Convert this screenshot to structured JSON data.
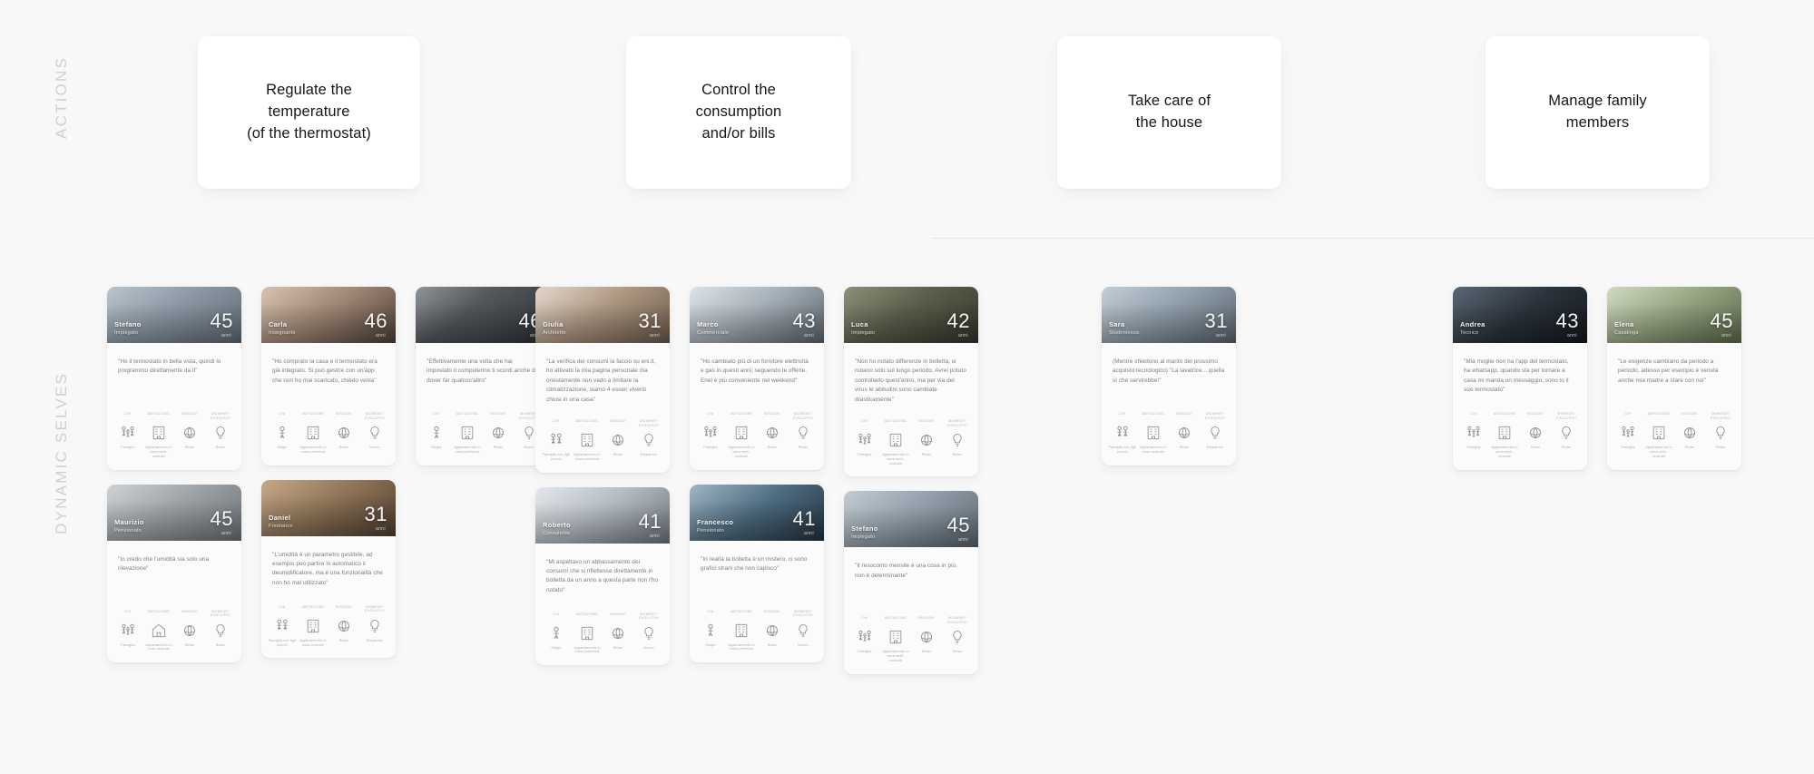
{
  "rails": {
    "actions": "ACTIONS",
    "dynamic_selves": "DYNAMIC SELVES"
  },
  "actions": {
    "cards": [
      {
        "label": "Regulate the\ntemperature\n(of the thermostat)"
      },
      {
        "label": "Control the\nconsumption\nand/or bills"
      },
      {
        "label": "Take care of\nthe house"
      },
      {
        "label": "Manage family\nmembers"
      }
    ]
  },
  "attribute_headers": [
    "CHI",
    "ABITAZIONE",
    "BISOGNI",
    "MOMENTI EVOLUTIVI"
  ],
  "columns": [
    {
      "rows": [
        [
          {
            "name": "Stefano",
            "role": "Impiegato",
            "age": "45",
            "age_unit": "anni",
            "photo": "ph-bed",
            "quote": "\"Ho il termostato in bella vista, quindi lo programmo direttamente da lì\"",
            "attrs": [
              {
                "head": "CHI",
                "icon": "family-icon",
                "cap": "Famiglia"
              },
              {
                "head": "ABITAZIONE",
                "icon": "building-icon",
                "cap": "Appartamento\nin zona semi-centrale"
              },
              {
                "head": "BISOGNI",
                "icon": "comfort-icon",
                "cap": "Relax"
              },
              {
                "head": "MOMENTI EVOLUTIVI",
                "icon": "lightbulb-icon",
                "cap": "Relax"
              }
            ]
          },
          {
            "name": "Carla",
            "role": "Insegnante",
            "age": "46",
            "age_unit": "anni",
            "photo": "ph-woman",
            "quote": "\"Ho comprato la casa e il termostato era già integrato. Si può gestire con un'app che non ho mai scaricato, chiedo venia\"",
            "attrs": [
              {
                "head": "CHI",
                "icon": "person-icon",
                "cap": "Single"
              },
              {
                "head": "ABITAZIONE",
                "icon": "building-icon",
                "cap": "Appartamento\nin zona periferica"
              },
              {
                "head": "BISOGNI",
                "icon": "comfort-icon",
                "cap": "Relax"
              },
              {
                "head": "MOMENTI EVOLUTIVI",
                "icon": "lightbulb-icon",
                "cap": "Nuovo"
              }
            ]
          },
          {
            "name": "",
            "role": "",
            "age": "46",
            "age_unit": "anni",
            "photo": "ph-thermo",
            "quote": "\"Effettivamente una volta che hai impostato il computerino ti scordi anche di dover far qualcos'altro\"",
            "attrs": [
              {
                "head": "CHI",
                "icon": "person-icon",
                "cap": "Single"
              },
              {
                "head": "ABITAZIONE",
                "icon": "building-icon",
                "cap": "Appartamento\nin zona periferica"
              },
              {
                "head": "BISOGNI",
                "icon": "comfort-icon",
                "cap": "Relax"
              },
              {
                "head": "MOMENTI EVOLUTIVI",
                "icon": "lightbulb-icon",
                "cap": "Nuovo"
              }
            ]
          }
        ],
        [
          {
            "name": "Maurizio",
            "role": "Pensionato",
            "age": "45",
            "age_unit": "anni",
            "photo": "ph-rad",
            "quote": "\"Io credo che l'umidità sia solo una rilevazione\"",
            "attrs": [
              {
                "head": "CHI",
                "icon": "family-icon",
                "cap": "Famiglia"
              },
              {
                "head": "ABITAZIONE",
                "icon": "house-icon",
                "cap": "Appartamento\nin zona centrale"
              },
              {
                "head": "BISOGNI",
                "icon": "comfort-icon",
                "cap": "Relax"
              },
              {
                "head": "MOMENTI EVOLUTIVI",
                "icon": "lightbulb-icon",
                "cap": "Relax"
              }
            ]
          },
          {
            "name": "Daniel",
            "role": "Freelance",
            "age": "31",
            "age_unit": "anni",
            "photo": "ph-sofa",
            "quote": "\"L'umidità è un parametro gestibile, ad esempio può partire in automatico il deumidificatore, ma è una funzionalità che non ho mai utilizzato\"",
            "attrs": [
              {
                "head": "CHI",
                "icon": "couple-icon",
                "cap": "Famiglia con\nfigli piccoli"
              },
              {
                "head": "ABITAZIONE",
                "icon": "building-icon",
                "cap": "Appartamento\nin zona centrale"
              },
              {
                "head": "BISOGNI",
                "icon": "comfort-icon",
                "cap": "Relax"
              },
              {
                "head": "MOMENTI EVOLUTIVI",
                "icon": "lightbulb-icon",
                "cap": "Risparmio"
              }
            ]
          }
        ]
      ]
    },
    {
      "rows": [
        [
          {
            "name": "Giulia",
            "role": "Architetto",
            "age": "31",
            "age_unit": "anni",
            "photo": "ph-poster",
            "quote": "\"La verifica dei consumi la faccio su eni.it, ho attivato la mia pagina personale ma onestamente non vado a limitare la climatizzazione, siamo 4 esseri viventi chiusi in una casa\"",
            "attrs": [
              {
                "head": "CHI",
                "icon": "couple-icon",
                "cap": "Famiglia con\nfigli piccoli"
              },
              {
                "head": "ABITAZIONE",
                "icon": "building-icon",
                "cap": "Appartamento\nin zona periferica"
              },
              {
                "head": "BISOGNI",
                "icon": "comfort-icon",
                "cap": "Relax"
              },
              {
                "head": "MOMENTI EVOLUTIVI",
                "icon": "lightbulb-icon",
                "cap": "Risparmio"
              }
            ]
          },
          {
            "name": "Marco",
            "role": "Commerciale",
            "age": "43",
            "age_unit": "anni",
            "photo": "ph-bill",
            "quote": "\"Ho cambiato più di un fornitore elettricità e gas in questi anni, seguendo le offerte. Enel è più conveniente nel weekend\"",
            "attrs": [
              {
                "head": "CHI",
                "icon": "family-icon",
                "cap": "Famiglia"
              },
              {
                "head": "ABITAZIONE",
                "icon": "building-icon",
                "cap": "Appartamento\nin zona semi-centrale"
              },
              {
                "head": "BISOGNI",
                "icon": "comfort-icon",
                "cap": "Relax"
              },
              {
                "head": "MOMENTI EVOLUTIVI",
                "icon": "lightbulb-icon",
                "cap": "Relax"
              }
            ]
          },
          {
            "name": "Luca",
            "role": "Impiegato",
            "age": "42",
            "age_unit": "anni",
            "photo": "ph-forest",
            "quote": "\"Non ho notato differenze in bolletta, si notano solo sul lungo periodo. Avrei potuto controllarlo quest'anno, ma per via del virus le abitudini sono cambiate drasticamente\"",
            "attrs": [
              {
                "head": "CHI",
                "icon": "family-icon",
                "cap": "Famiglia"
              },
              {
                "head": "ABITAZIONE",
                "icon": "building-icon",
                "cap": "Appartamento\nin zona semi-centrale"
              },
              {
                "head": "BISOGNI",
                "icon": "comfort-icon",
                "cap": "Relax"
              },
              {
                "head": "MOMENTI EVOLUTIVI",
                "icon": "lightbulb-icon",
                "cap": "Relax"
              }
            ]
          }
        ],
        [
          {
            "name": "Roberto",
            "role": "Consulente",
            "age": "41",
            "age_unit": "anni",
            "photo": "ph-calc",
            "quote": "\"Mi aspettavo un abbassamento dei consumi che si riflettesse direttamente in bolletta da un anno a questa parte non l'ho notato\"",
            "attrs": [
              {
                "head": "CHI",
                "icon": "person-icon",
                "cap": "Single"
              },
              {
                "head": "ABITAZIONE",
                "icon": "building-icon",
                "cap": "Appartamento\nin zona periferica"
              },
              {
                "head": "BISOGNI",
                "icon": "comfort-icon",
                "cap": "Relax"
              },
              {
                "head": "MOMENTI EVOLUTIVI",
                "icon": "lightbulb-icon",
                "cap": "Nuovo"
              }
            ]
          },
          {
            "name": "Francesco",
            "role": "Pensionato",
            "age": "41",
            "age_unit": "anni",
            "photo": "ph-relax",
            "quote": "\"In realtà la bolletta è un mistero, ci sono grafici strani che non capisco\"",
            "attrs": [
              {
                "head": "CHI",
                "icon": "person-icon",
                "cap": "Single"
              },
              {
                "head": "ABITAZIONE",
                "icon": "building-icon",
                "cap": "Appartamento\nin zona periferica"
              },
              {
                "head": "BISOGNI",
                "icon": "comfort-icon",
                "cap": "Relax"
              },
              {
                "head": "MOMENTI EVOLUTIVI",
                "icon": "lightbulb-icon",
                "cap": "Nuovo"
              }
            ]
          },
          {
            "name": "Stefano",
            "role": "Impiegato",
            "age": "45",
            "age_unit": "anni",
            "photo": "ph-laptop",
            "quote": "\"Il resoconto mensile è una cosa in più, non è determinante\"",
            "attrs": [
              {
                "head": "CHI",
                "icon": "family-icon",
                "cap": "Famiglia"
              },
              {
                "head": "ABITAZIONE",
                "icon": "building-icon",
                "cap": "Appartamento\nin zona semi-centrale"
              },
              {
                "head": "BISOGNI",
                "icon": "comfort-icon",
                "cap": "Relax"
              },
              {
                "head": "MOMENTI EVOLUTIVI",
                "icon": "lightbulb-icon",
                "cap": "Relax"
              }
            ]
          }
        ]
      ]
    },
    {
      "rows": [
        [
          {
            "name": "Sara",
            "role": "Studentessa",
            "age": "31",
            "age_unit": "anni",
            "photo": "ph-dog",
            "quote": "(Mentre chiedono al marito del prossimo acquisto tecnologico) \"La lavatrice... quella sì che servirebbe!\"",
            "attrs": [
              {
                "head": "CHI",
                "icon": "couple-icon",
                "cap": "Famiglia con\nfigli piccoli"
              },
              {
                "head": "ABITAZIONE",
                "icon": "building-icon",
                "cap": "Appartamento\nin zona centrale"
              },
              {
                "head": "BISOGNI",
                "icon": "comfort-icon",
                "cap": "Relax"
              },
              {
                "head": "MOMENTI EVOLUTIVI",
                "icon": "lightbulb-icon",
                "cap": "Risparmio"
              }
            ]
          }
        ]
      ]
    },
    {
      "rows": [
        [
          {
            "name": "Andrea",
            "role": "Tecnico",
            "age": "43",
            "age_unit": "anni",
            "photo": "ph-phone",
            "quote": "\"Mia moglie non ha l'app del termostato, ha whatsapp, quando sta per tornare a casa mi manda un messaggio, sono io il suo termostato\"",
            "attrs": [
              {
                "head": "CHI",
                "icon": "family-icon",
                "cap": "Famiglia"
              },
              {
                "head": "ABITAZIONE",
                "icon": "building-icon",
                "cap": "Appartamento\nin zona semi-centrale"
              },
              {
                "head": "BISOGNI",
                "icon": "comfort-icon",
                "cap": "Relax"
              },
              {
                "head": "MOMENTI EVOLUTIVI",
                "icon": "lightbulb-icon",
                "cap": "Relax"
              }
            ]
          },
          {
            "name": "Elena",
            "role": "Casalinga",
            "age": "45",
            "age_unit": "anni",
            "photo": "ph-kitchen",
            "quote": "\"Le esigenze cambiano da periodo a periodo, adesso per esempio è venuta anche mia madre a stare con noi\"",
            "attrs": [
              {
                "head": "CHI",
                "icon": "family-icon",
                "cap": "Famiglia"
              },
              {
                "head": "ABITAZIONE",
                "icon": "building-icon",
                "cap": "Appartamento\nin zona semi-centrale"
              },
              {
                "head": "BISOGNI",
                "icon": "comfort-icon",
                "cap": "Relax"
              },
              {
                "head": "MOMENTI EVOLUTIVI",
                "icon": "lightbulb-icon",
                "cap": "Relax"
              }
            ]
          }
        ]
      ]
    }
  ]
}
